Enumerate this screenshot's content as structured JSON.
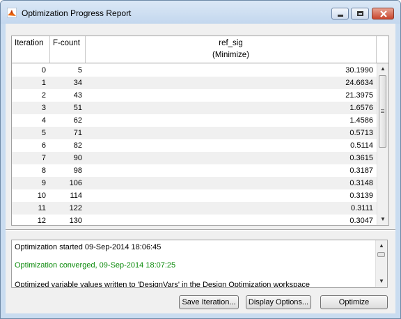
{
  "window": {
    "title": "Optimization Progress Report"
  },
  "table": {
    "headers": {
      "iteration": "Iteration",
      "fcount": "F-count",
      "signal": "ref_sig",
      "signal_sub": "(Minimize)"
    },
    "rows": [
      {
        "iter": "0",
        "fcount": "5",
        "value": "30.1990"
      },
      {
        "iter": "1",
        "fcount": "34",
        "value": "24.6634"
      },
      {
        "iter": "2",
        "fcount": "43",
        "value": "21.3975"
      },
      {
        "iter": "3",
        "fcount": "51",
        "value": "1.6576"
      },
      {
        "iter": "4",
        "fcount": "62",
        "value": "1.4586"
      },
      {
        "iter": "5",
        "fcount": "71",
        "value": "0.5713"
      },
      {
        "iter": "6",
        "fcount": "82",
        "value": "0.5114"
      },
      {
        "iter": "7",
        "fcount": "90",
        "value": "0.3615"
      },
      {
        "iter": "8",
        "fcount": "98",
        "value": "0.3187"
      },
      {
        "iter": "9",
        "fcount": "106",
        "value": "0.3148"
      },
      {
        "iter": "10",
        "fcount": "114",
        "value": "0.3139"
      },
      {
        "iter": "11",
        "fcount": "122",
        "value": "0.3111"
      },
      {
        "iter": "12",
        "fcount": "130",
        "value": "0.3047"
      }
    ]
  },
  "log": {
    "lines": [
      {
        "text": "Optimization started 09-Sep-2014 18:06:45",
        "color": "#000000"
      },
      {
        "text": "Optimization converged, 09-Sep-2014 18:07:25",
        "color": "#0a8a0a"
      },
      {
        "text": "Optimized variable values written to 'DesignVars' in the Design Optimization workspace",
        "color": "#000000"
      }
    ]
  },
  "buttons": {
    "save": "Save Iteration...",
    "display": "Display Options...",
    "optimize": "Optimize"
  },
  "icons": {
    "app": "matlab-icon",
    "minimize": "minimize-icon",
    "maximize": "maximize-icon",
    "close": "close-icon",
    "scroll_up": "arrow-up-icon",
    "scroll_down": "arrow-down-icon"
  }
}
